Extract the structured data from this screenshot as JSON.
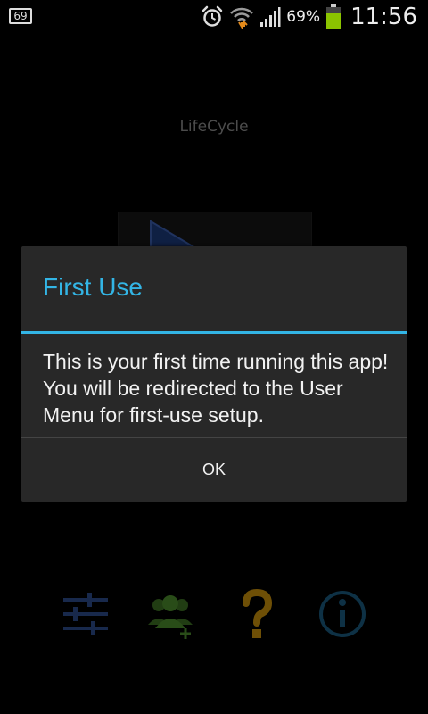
{
  "status_bar": {
    "notification_badge": "69",
    "battery_percent": "69%",
    "time": "11:56",
    "icons": [
      "notification-icon",
      "alarm-icon",
      "wifi-icon",
      "signal-icon",
      "battery-icon"
    ]
  },
  "app": {
    "title": "LifeCycle",
    "bottom_icons": [
      "settings-sliders-icon",
      "add-users-icon",
      "help-icon",
      "info-icon"
    ]
  },
  "dialog": {
    "title": "First Use",
    "message": "This is your first time running this app! You will be redirected to the User Menu for first-use setup.",
    "ok_label": "OK"
  },
  "colors": {
    "accent": "#33b5e5",
    "dialog_bg": "#282828",
    "battery": "#8bc400",
    "help": "#c8900c",
    "users": "#4c8a2c",
    "settings": "#2c4b8a"
  }
}
